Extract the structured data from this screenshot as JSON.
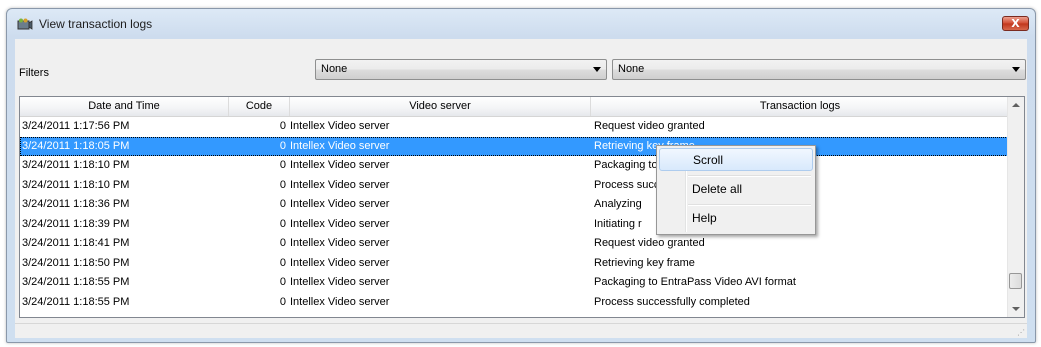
{
  "window": {
    "title": "View transaction logs",
    "close_label": "X"
  },
  "filters": {
    "label": "Filters",
    "filter1": {
      "value": "None"
    },
    "filter2": {
      "value": "None"
    }
  },
  "grid": {
    "columns": [
      "Date and Time",
      "Code",
      "Video server",
      "Transaction logs"
    ],
    "rows": [
      {
        "datetime": "3/24/2011 1:17:56 PM",
        "code": "0",
        "server": "Intellex Video server",
        "log": "Request video granted",
        "selected": false
      },
      {
        "datetime": "3/24/2011 1:18:05 PM",
        "code": "0",
        "server": "Intellex Video server",
        "log": "Retrieving key frame",
        "selected": true
      },
      {
        "datetime": "3/24/2011 1:18:10 PM",
        "code": "0",
        "server": "Intellex Video server",
        "log": "Packaging to EntraPass Video AVI format",
        "selected": false
      },
      {
        "datetime": "3/24/2011 1:18:10 PM",
        "code": "0",
        "server": "Intellex Video server",
        "log": "Process successfully completed",
        "selected": false
      },
      {
        "datetime": "3/24/2011 1:18:36 PM",
        "code": "0",
        "server": "Intellex Video server",
        "log": "Analyzing",
        "selected": false
      },
      {
        "datetime": "3/24/2011 1:18:39 PM",
        "code": "0",
        "server": "Intellex Video server",
        "log": "Initiating r",
        "selected": false
      },
      {
        "datetime": "3/24/2011 1:18:41 PM",
        "code": "0",
        "server": "Intellex Video server",
        "log": "Request video granted",
        "selected": false
      },
      {
        "datetime": "3/24/2011 1:18:50 PM",
        "code": "0",
        "server": "Intellex Video server",
        "log": "Retrieving key frame",
        "selected": false
      },
      {
        "datetime": "3/24/2011 1:18:55 PM",
        "code": "0",
        "server": "Intellex Video server",
        "log": "Packaging to EntraPass Video AVI format",
        "selected": false
      },
      {
        "datetime": "3/24/2011 1:18:55 PM",
        "code": "0",
        "server": "Intellex Video server",
        "log": "Process successfully completed",
        "selected": false
      }
    ]
  },
  "context_menu": {
    "items": [
      "Scroll",
      "Delete all",
      "Help"
    ],
    "highlighted": "Scroll"
  },
  "colors": {
    "selection": "#3399ff",
    "close_button": "#c9422a"
  },
  "icons": {
    "app": "camera-log-icon",
    "close": "close-icon",
    "dropdown": "chevron-down-icon"
  }
}
